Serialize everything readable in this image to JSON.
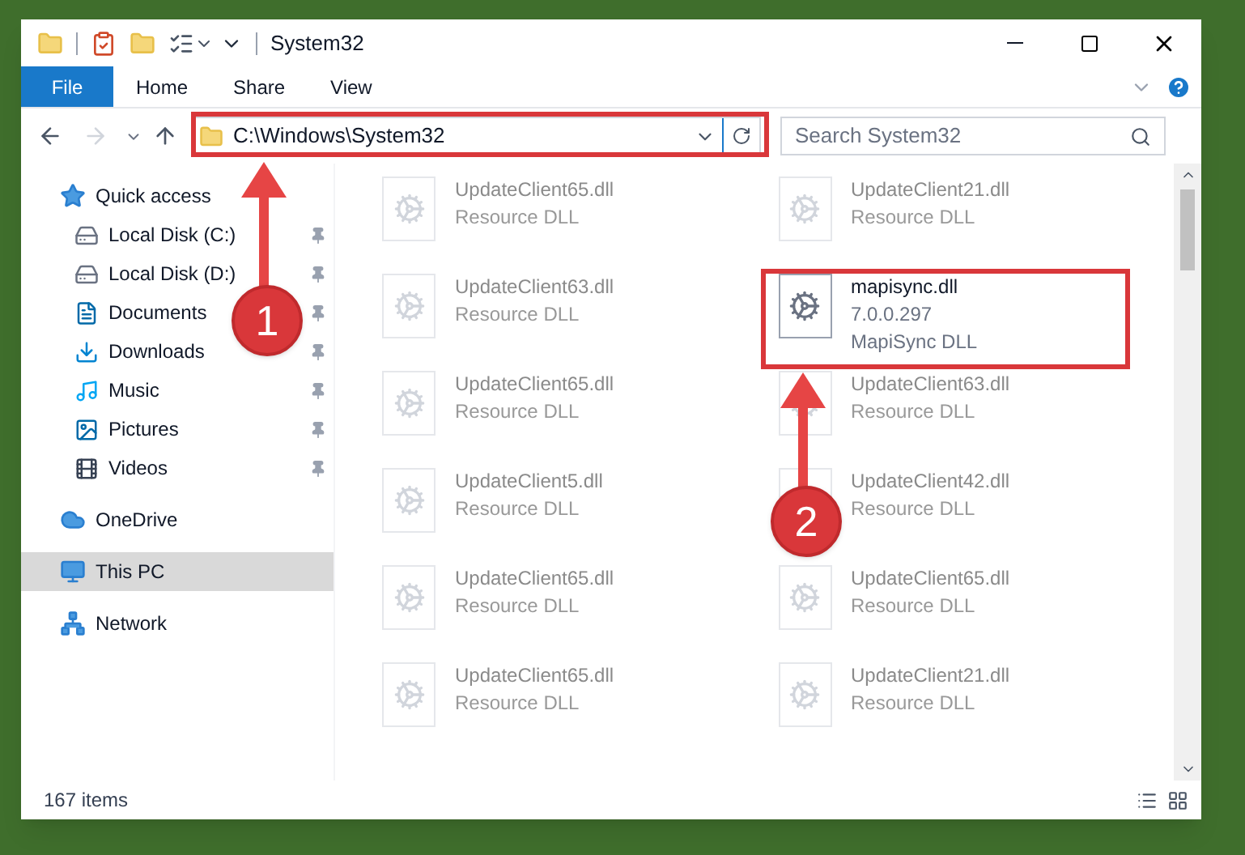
{
  "window": {
    "title": "System32"
  },
  "ribbon_tabs": [
    {
      "label": "File",
      "selected": true
    },
    {
      "label": "Home",
      "selected": false
    },
    {
      "label": "Share",
      "selected": false
    },
    {
      "label": "View",
      "selected": false
    }
  ],
  "address": {
    "path": "C:\\Windows\\System32"
  },
  "search": {
    "placeholder": "Search System32"
  },
  "nav": [
    {
      "label": "Quick access",
      "selected": false,
      "children": [
        {
          "label": "Local Disk (C:)",
          "pinned": true
        },
        {
          "label": "Local Disk (D:)",
          "pinned": true
        },
        {
          "label": "Documents",
          "pinned": true
        },
        {
          "label": "Downloads",
          "pinned": true
        },
        {
          "label": "Music",
          "pinned": true
        },
        {
          "label": "Pictures",
          "pinned": true
        },
        {
          "label": "Videos",
          "pinned": true
        }
      ]
    },
    {
      "label": "OneDrive",
      "selected": false
    },
    {
      "label": "This PC",
      "selected": true
    },
    {
      "label": "Network",
      "selected": false
    }
  ],
  "files": [
    {
      "name": "UpdateClient65.dll",
      "lines": [
        "Resource DLL"
      ],
      "blurred": true
    },
    {
      "name": "UpdateClient21.dll",
      "lines": [
        "Resource DLL"
      ],
      "blurred": true
    },
    {
      "name": "UpdateClient63.dll",
      "lines": [
        "Resource DLL"
      ],
      "blurred": true
    },
    {
      "name": "mapisync.dll",
      "lines": [
        "7.0.0.297",
        "MapiSync DLL"
      ],
      "blurred": false
    },
    {
      "name": "UpdateClient65.dll",
      "lines": [
        "Resource DLL"
      ],
      "blurred": true
    },
    {
      "name": "UpdateClient63.dll",
      "lines": [
        "Resource DLL"
      ],
      "blurred": true
    },
    {
      "name": "UpdateClient5.dll",
      "lines": [
        "Resource DLL"
      ],
      "blurred": true
    },
    {
      "name": "UpdateClient42.dll",
      "lines": [
        "Resource DLL"
      ],
      "blurred": true
    },
    {
      "name": "UpdateClient65.dll",
      "lines": [
        "Resource DLL"
      ],
      "blurred": true
    },
    {
      "name": "UpdateClient65.dll",
      "lines": [
        "Resource DLL"
      ],
      "blurred": true
    },
    {
      "name": "UpdateClient65.dll",
      "lines": [
        "Resource DLL"
      ],
      "blurred": true
    },
    {
      "name": "UpdateClient21.dll",
      "lines": [
        "Resource DLL"
      ],
      "blurred": true
    }
  ],
  "status_bar": {
    "item_count": "167 items"
  },
  "annotations": [
    {
      "label": "1"
    },
    {
      "label": "2"
    }
  ]
}
